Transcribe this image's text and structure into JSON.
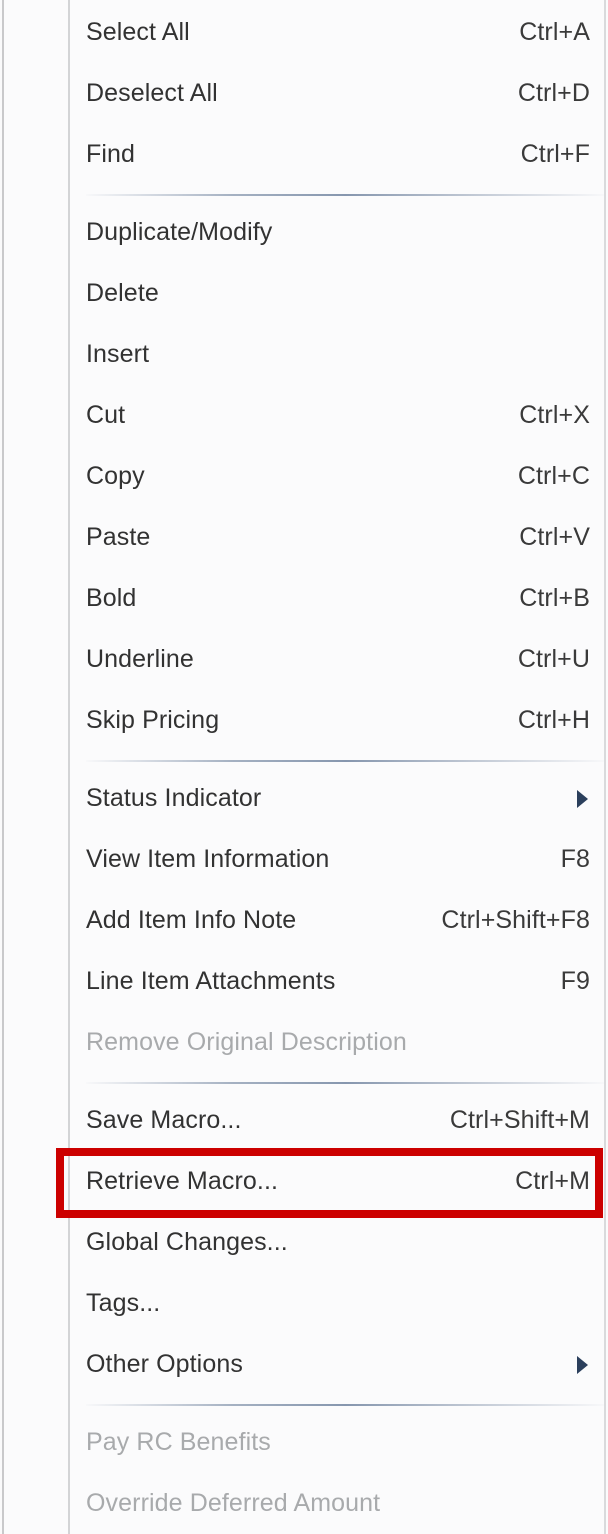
{
  "menu": {
    "type": "context-menu",
    "background_color": "#fbfbfc",
    "text_color": "#323232",
    "disabled_text_color": "#a8aaac",
    "submenu_arrow_color": "#2b3f5c",
    "highlight_color": "#cc0000",
    "groups": [
      {
        "items": [
          {
            "label": "Select All",
            "accel": "Ctrl+A",
            "disabled": false,
            "submenu": false
          },
          {
            "label": "Deselect All",
            "accel": "Ctrl+D",
            "disabled": false,
            "submenu": false
          },
          {
            "label": "Find",
            "accel": "Ctrl+F",
            "disabled": false,
            "submenu": false
          }
        ]
      },
      {
        "items": [
          {
            "label": "Duplicate/Modify",
            "accel": "",
            "disabled": false,
            "submenu": false
          },
          {
            "label": "Delete",
            "accel": "",
            "disabled": false,
            "submenu": false
          },
          {
            "label": "Insert",
            "accel": "",
            "disabled": false,
            "submenu": false
          },
          {
            "label": "Cut",
            "accel": "Ctrl+X",
            "disabled": false,
            "submenu": false
          },
          {
            "label": "Copy",
            "accel": "Ctrl+C",
            "disabled": false,
            "submenu": false
          },
          {
            "label": "Paste",
            "accel": "Ctrl+V",
            "disabled": false,
            "submenu": false
          },
          {
            "label": "Bold",
            "accel": "Ctrl+B",
            "disabled": false,
            "submenu": false
          },
          {
            "label": "Underline",
            "accel": "Ctrl+U",
            "disabled": false,
            "submenu": false
          },
          {
            "label": "Skip Pricing",
            "accel": "Ctrl+H",
            "disabled": false,
            "submenu": false
          }
        ]
      },
      {
        "items": [
          {
            "label": "Status Indicator",
            "accel": "",
            "disabled": false,
            "submenu": true
          },
          {
            "label": "View Item Information",
            "accel": "F8",
            "disabled": false,
            "submenu": false
          },
          {
            "label": "Add Item Info Note",
            "accel": "Ctrl+Shift+F8",
            "disabled": false,
            "submenu": false
          },
          {
            "label": "Line Item Attachments",
            "accel": "F9",
            "disabled": false,
            "submenu": false
          },
          {
            "label": "Remove Original Description",
            "accel": "",
            "disabled": true,
            "submenu": false
          }
        ]
      },
      {
        "items": [
          {
            "label": "Save Macro...",
            "accel": "Ctrl+Shift+M",
            "disabled": false,
            "submenu": false
          },
          {
            "label": "Retrieve Macro...",
            "accel": "Ctrl+M",
            "disabled": false,
            "submenu": false,
            "highlighted": true
          },
          {
            "label": "Global Changes...",
            "accel": "",
            "disabled": false,
            "submenu": false
          },
          {
            "label": "Tags...",
            "accel": "",
            "disabled": false,
            "submenu": false
          },
          {
            "label": "Other Options",
            "accel": "",
            "disabled": false,
            "submenu": true
          }
        ]
      },
      {
        "items": [
          {
            "label": "Pay RC Benefits",
            "accel": "",
            "disabled": true,
            "submenu": false
          },
          {
            "label": "Override Deferred Amount",
            "accel": "",
            "disabled": true,
            "submenu": false
          }
        ]
      }
    ]
  }
}
